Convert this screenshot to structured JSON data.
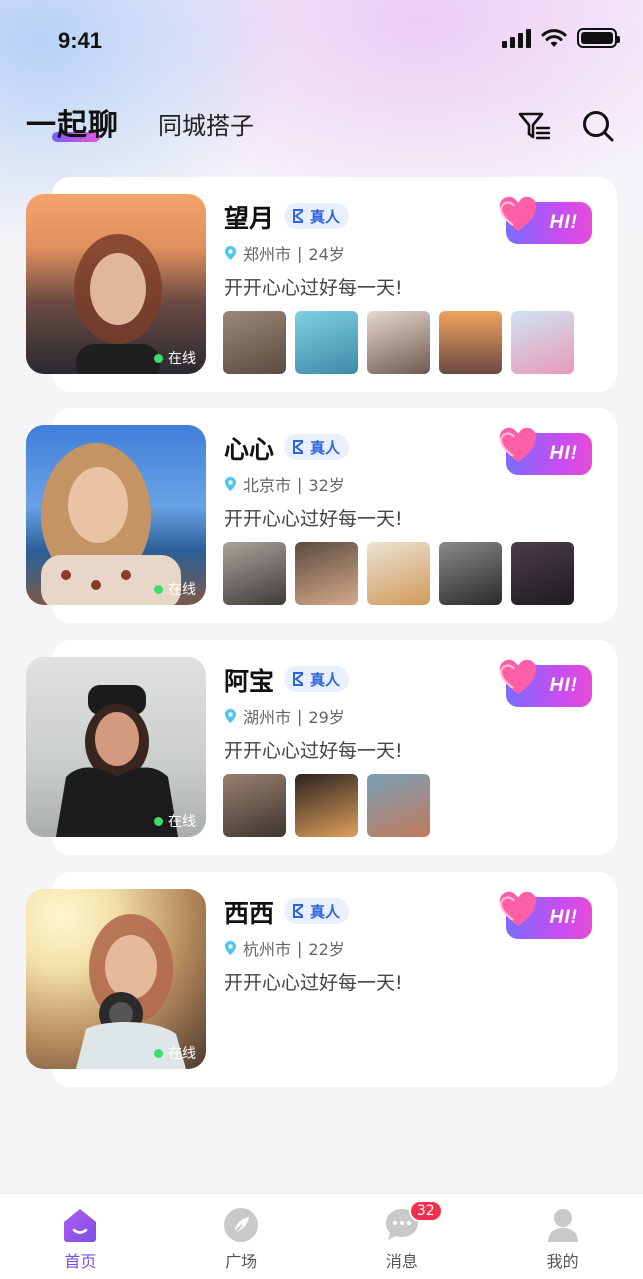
{
  "status_bar": {
    "time": "9:41"
  },
  "header": {
    "tabs": [
      {
        "label": "一起聊",
        "active": true
      },
      {
        "label": "同城搭子",
        "active": false
      }
    ],
    "filter_icon": "filter-icon",
    "search_icon": "search-icon"
  },
  "users": [
    {
      "name": "望月",
      "verified_label": "真人",
      "city": "郑州市",
      "age": "24岁",
      "motto": "开开心心过好每一天!",
      "status": "在线",
      "avatar_colors": [
        "#f2a46b",
        "#6b4a43",
        "#2a2a30"
      ],
      "photo_count": 5,
      "photo_colors": [
        "#7c6a5c",
        "#5bb1c9",
        "#c7b8ad",
        "#d9905e",
        "#b7d2e8"
      ],
      "hi_label": "HI!"
    },
    {
      "name": "心心",
      "verified_label": "真人",
      "city": "北京市",
      "age": "32岁",
      "motto": "开开心心过好每一天!",
      "status": "在线",
      "avatar_colors": [
        "#3f7fd8",
        "#d9b18c",
        "#7a4b3a"
      ],
      "photo_count": 5,
      "photo_colors": [
        "#8a8580",
        "#3d3a36",
        "#d8c4a8",
        "#4a4a4a",
        "#2e2a2f"
      ],
      "hi_label": "HI!"
    },
    {
      "name": "阿宝",
      "verified_label": "真人",
      "city": "湖州市",
      "age": "29岁",
      "motto": "开开心心过好每一天!",
      "status": "在线",
      "avatar_colors": [
        "#d8dbd9",
        "#1c1c1e",
        "#c98f72"
      ],
      "photo_count": 3,
      "photo_colors": [
        "#6e5a4c",
        "#c98a4e",
        "#5a7a8c"
      ],
      "hi_label": "HI!"
    },
    {
      "name": "西西",
      "verified_label": "真人",
      "city": "杭州市",
      "age": "22岁",
      "motto": "开开心心过好每一天!",
      "status": "在线",
      "avatar_colors": [
        "#f3e1a8",
        "#b36a4e",
        "#2a2a2a"
      ],
      "photo_count": 0,
      "photo_colors": [],
      "hi_label": "HI!"
    }
  ],
  "tabbar": {
    "items": [
      {
        "label": "首页",
        "icon": "home-icon",
        "active": true
      },
      {
        "label": "广场",
        "icon": "plaza-icon",
        "active": false
      },
      {
        "label": "消息",
        "icon": "message-icon",
        "active": false,
        "badge": "32"
      },
      {
        "label": "我的",
        "icon": "profile-icon",
        "active": false
      }
    ]
  },
  "colors": {
    "accent": "#7a4fe6",
    "online": "#3ddc6b",
    "badge": "#f22f4a",
    "verify_text": "#2f63e0"
  }
}
